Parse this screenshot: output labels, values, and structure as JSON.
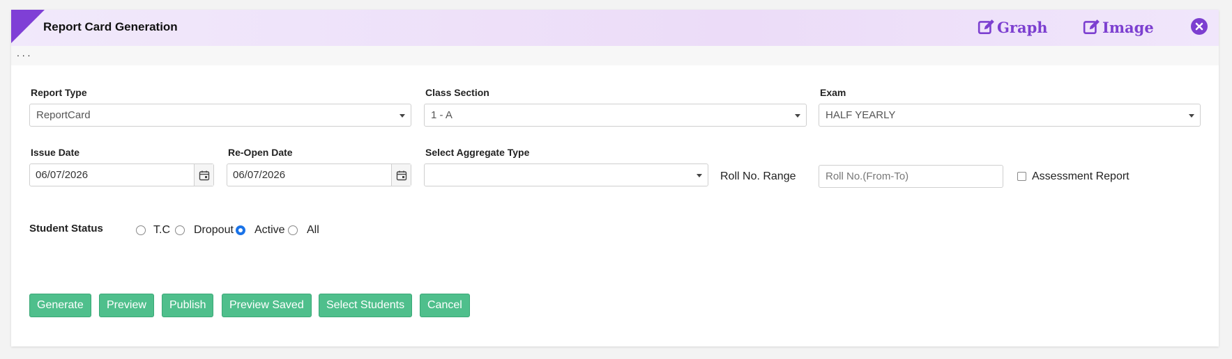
{
  "header": {
    "title": "Report Card Generation",
    "graph_label": "Graph",
    "image_label": "Image"
  },
  "subbar": {
    "dots": ".   .   ."
  },
  "form": {
    "report_type": {
      "label": "Report Type",
      "value": "ReportCard"
    },
    "class_section": {
      "label": "Class Section",
      "value": "1 - A"
    },
    "exam": {
      "label": "Exam",
      "value": "HALF YEARLY"
    },
    "issue_date": {
      "label": "Issue Date",
      "value": "06/07/2026"
    },
    "reopen_date": {
      "label": "Re-Open Date",
      "value": "06/07/2026"
    },
    "aggregate_type": {
      "label": "Select Aggregate Type",
      "value": ""
    },
    "roll_range": {
      "label": "Roll No. Range",
      "placeholder": "Roll No.(From-To)",
      "value": ""
    },
    "assessment": {
      "label": "Assessment Report",
      "checked": false
    }
  },
  "student_status": {
    "label": "Student Status",
    "options": [
      {
        "label": "T.C",
        "selected": false
      },
      {
        "label": "Dropout",
        "selected": false
      },
      {
        "label": "Active",
        "selected": true
      },
      {
        "label": "All",
        "selected": false
      }
    ]
  },
  "buttons": {
    "generate": "Generate",
    "preview": "Preview",
    "publish": "Publish",
    "preview_saved": "Preview Saved",
    "select_students": "Select Students",
    "cancel": "Cancel"
  },
  "colors": {
    "accent": "#7c3fd0",
    "button": "#4fbf8c",
    "radio_selected": "#1a73e8"
  },
  "icons": {
    "graph": "edit-icon",
    "image": "edit-icon",
    "close": "close-circle-icon",
    "date": "calendar-icon",
    "select": "caret-down-icon"
  }
}
